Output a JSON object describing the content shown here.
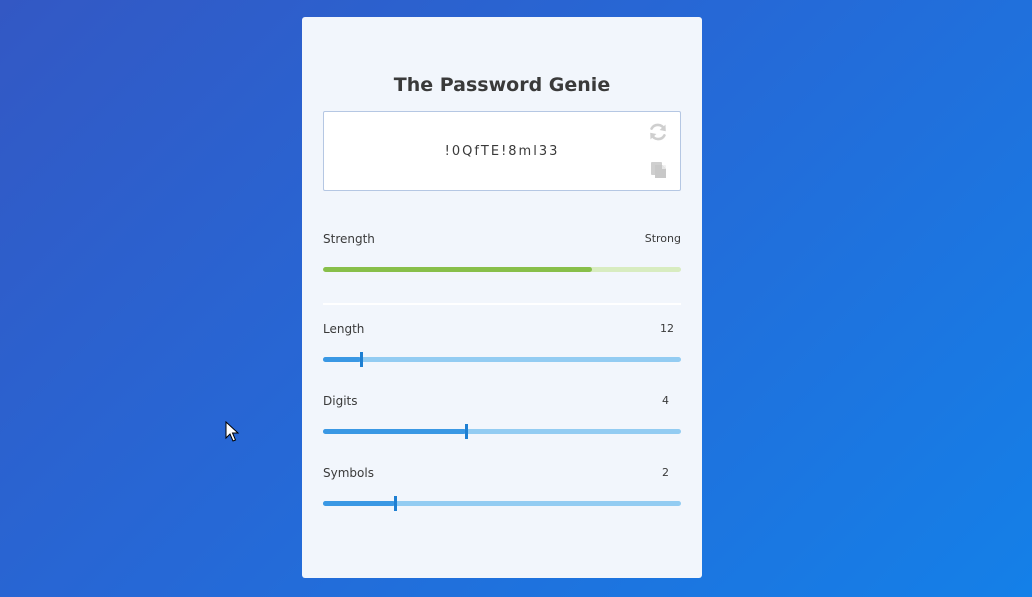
{
  "app": {
    "title": "The Password Genie"
  },
  "password": {
    "value": "!0QfTE!8ml33",
    "refresh_icon": "refresh-icon",
    "copy_icon": "copy-icon"
  },
  "strength": {
    "label": "Strength",
    "value": "Strong",
    "level": 0.75,
    "colors": {
      "fill": "#88bf4a",
      "track": "#d8ecc0"
    }
  },
  "settings": {
    "length": {
      "label": "Length",
      "value": "12",
      "fraction": 0.105
    },
    "digits": {
      "label": "Digits",
      "value": "4",
      "fraction": 0.4
    },
    "symbols": {
      "label": "Symbols",
      "value": "2",
      "fraction": 0.2
    }
  },
  "colors": {
    "background_start": "#3358c4",
    "background_end": "#1480e8",
    "card": "#f2f6fc",
    "slider_track": "#93ccf2",
    "slider_fill": "#3a98e4"
  }
}
